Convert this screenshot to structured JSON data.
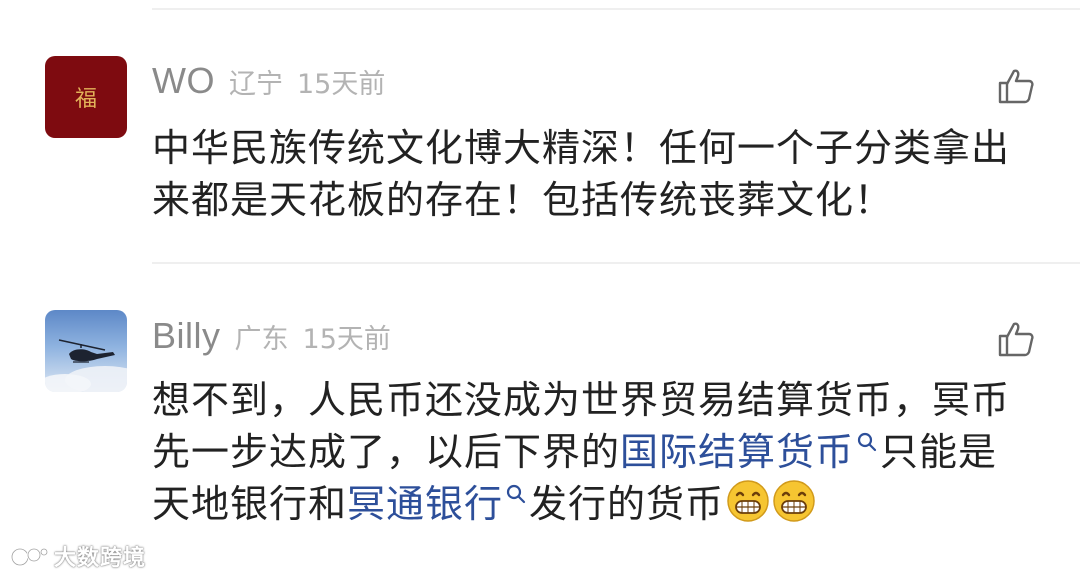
{
  "comments": [
    {
      "avatar_text": "福",
      "username": "WO",
      "location": "辽宁",
      "time": "15天前",
      "like_icon": "thumbs-up-icon",
      "text_lines": [
        "中华民族传统文化博大精深！任何一个子分类拿出",
        "来都是天花板的存在！包括传统丧葬文化！"
      ]
    },
    {
      "avatar_image": "helicopter-sky",
      "username": "Billy",
      "location": "广东",
      "time": "15天前",
      "like_icon": "thumbs-up-icon",
      "text_line1": "想不到，人民币还没成为世界贸易结算货币，冥币",
      "text_line2_a": "先一步达成了，以后下界的",
      "link1": "国际结算货币",
      "text_line2_b": "只能是",
      "text_line3_a": "天地银行和",
      "link2": "冥通银行",
      "text_line3_b": "发行的货币"
    }
  ],
  "watermark": "大数跨境",
  "colors": {
    "link": "#2d4f9a",
    "username": "#8a8a8a",
    "meta": "#b3b3b3",
    "body": "#222222"
  }
}
